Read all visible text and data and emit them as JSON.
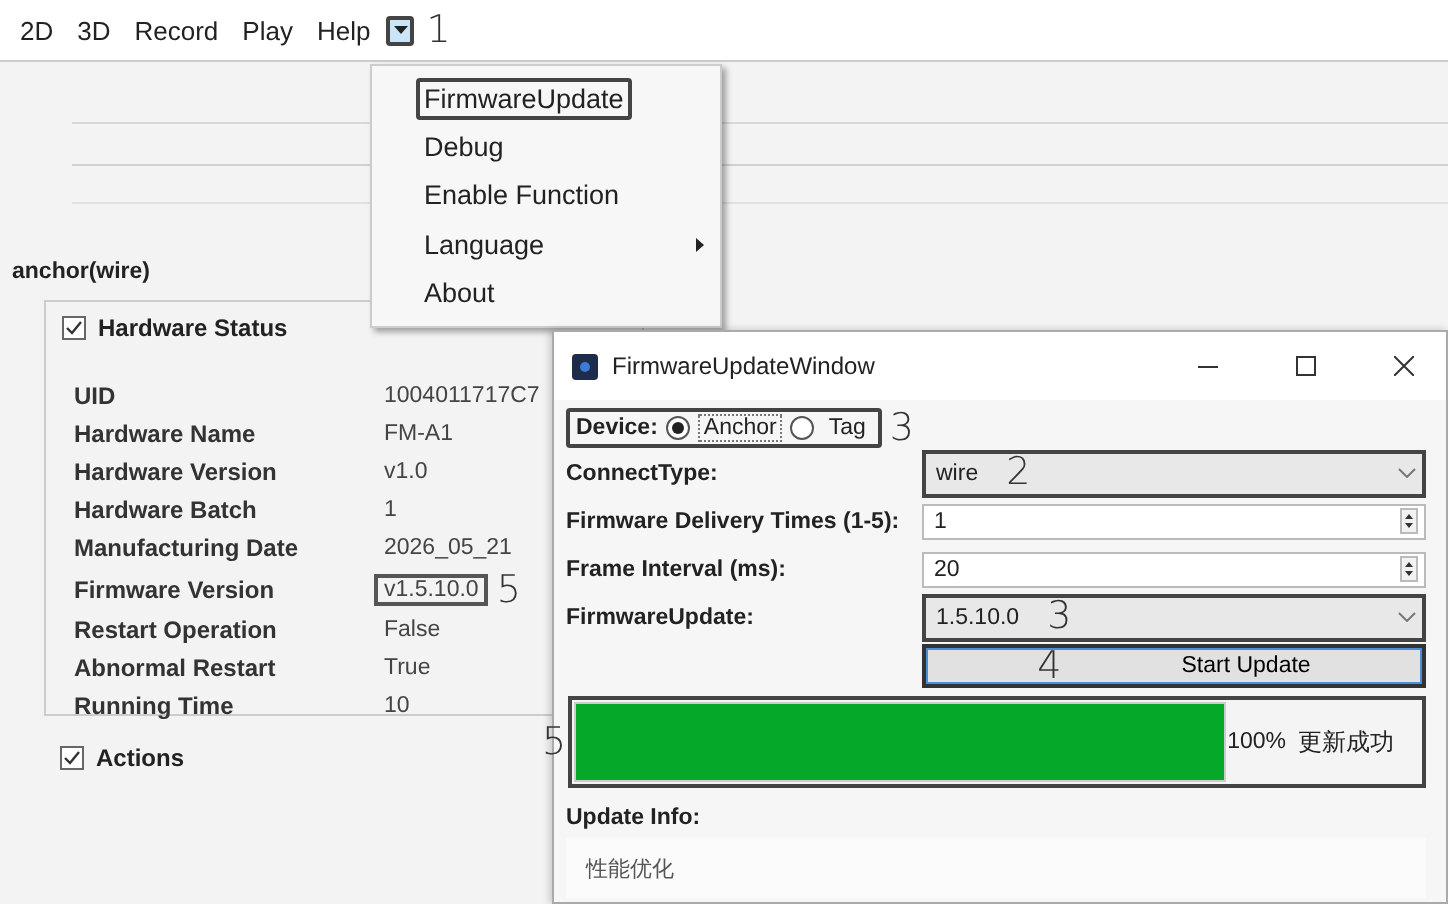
{
  "menu_bar": {
    "items": [
      {
        "label": "2D"
      },
      {
        "label": "3D"
      },
      {
        "label": "Record"
      },
      {
        "label": "Play"
      },
      {
        "label": "Help"
      }
    ],
    "dropdown": {
      "highlighted": true,
      "callout": "1"
    }
  },
  "help_menu": {
    "items": [
      {
        "label": "FirmwareUpdate",
        "highlighted": true,
        "submenu": false
      },
      {
        "label": "Debug",
        "highlighted": false,
        "submenu": false
      },
      {
        "label": "Enable Function",
        "highlighted": false,
        "submenu": false
      },
      {
        "label": "Language",
        "highlighted": false,
        "submenu": true
      },
      {
        "label": "About",
        "highlighted": false,
        "submenu": false
      }
    ]
  },
  "panel": {
    "title": "anchor(wire)",
    "hardware_status": {
      "label": "Hardware Status",
      "checked": true,
      "rows": [
        {
          "label": "UID",
          "value": "1004011717C7",
          "highlighted": false
        },
        {
          "label": "Hardware Name",
          "value": "FM-A1",
          "highlighted": false
        },
        {
          "label": "Hardware Version",
          "value": "v1.0",
          "highlighted": false
        },
        {
          "label": "Hardware Batch",
          "value": "1",
          "highlighted": false
        },
        {
          "label": "Manufacturing Date",
          "value": "2026_05_21",
          "highlighted": false
        },
        {
          "label": "Firmware Version",
          "value": "v1.5.10.0",
          "highlighted": true,
          "callout": "5"
        },
        {
          "label": "Restart Operation",
          "value": "False",
          "highlighted": false
        },
        {
          "label": "Abnormal Restart",
          "value": "True",
          "highlighted": false
        },
        {
          "label": "Running Time",
          "value": "10",
          "highlighted": false
        }
      ]
    },
    "actions": {
      "label": "Actions",
      "checked": true
    }
  },
  "dialog": {
    "title": "FirmwareUpdateWindow",
    "device": {
      "label": "Device:",
      "highlighted": true,
      "callout": "3",
      "options": [
        {
          "label": "Anchor",
          "selected": true
        },
        {
          "label": "Tag",
          "selected": false
        }
      ]
    },
    "fields": [
      {
        "kind": "combo",
        "label": "ConnectType:",
        "value": "wire",
        "highlighted": true,
        "callout": "2"
      },
      {
        "kind": "spin",
        "label": "Firmware Delivery Times (1-5):",
        "value": "1",
        "highlighted": false
      },
      {
        "kind": "spin",
        "label": "Frame Interval (ms):",
        "value": "20",
        "highlighted": false
      },
      {
        "kind": "combo",
        "label": "FirmwareUpdate:",
        "value": "1.5.10.0",
        "highlighted": true,
        "callout": "3"
      }
    ],
    "start_button": {
      "label": "Start Update",
      "highlighted": true,
      "callout": "4"
    },
    "progress": {
      "level": 1.0,
      "percent": "100%",
      "status": "更新成功",
      "highlighted": true,
      "callout": "5"
    },
    "update_info": {
      "label": "Update Info:",
      "text": "性能优化"
    }
  }
}
